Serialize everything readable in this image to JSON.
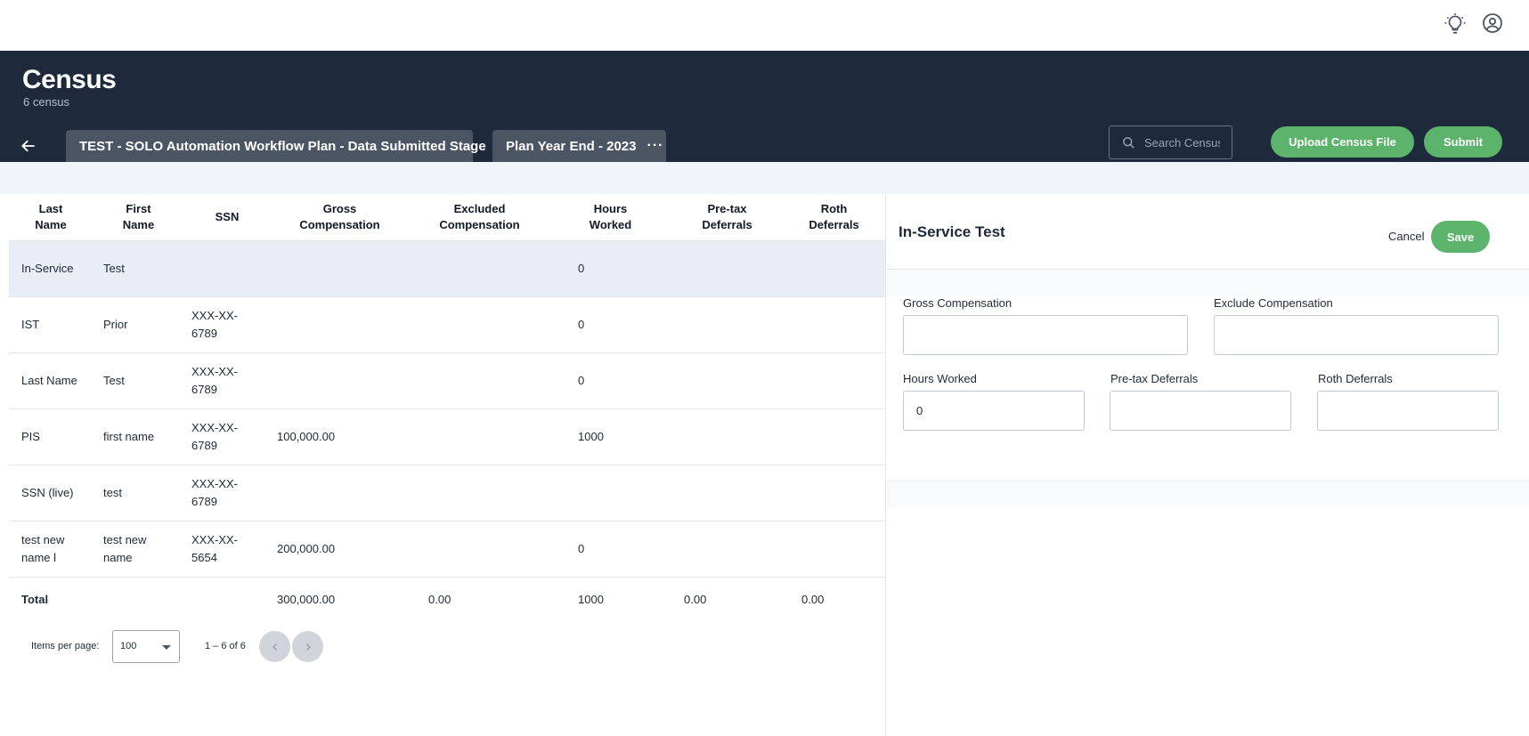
{
  "topbar": {
    "icons": [
      "lightbulb-icon",
      "account-circle-icon"
    ]
  },
  "header": {
    "title": "Census",
    "subtitle": "6 census",
    "tabs": [
      {
        "label": "TEST - SOLO Automation Workflow Plan - Data Submitted Stage"
      },
      {
        "label": "Plan Year End - 2023",
        "menu": "···"
      }
    ],
    "search": {
      "placeholder": "Search Census"
    },
    "upload_label": "Upload Census File",
    "submit_label": "Submit"
  },
  "table": {
    "columns": [
      {
        "line1": "Last",
        "line2": "Name"
      },
      {
        "line1": "First",
        "line2": "Name"
      },
      {
        "line1": "SSN",
        "line2": ""
      },
      {
        "line1": "Gross",
        "line2": "Compensation"
      },
      {
        "line1": "Excluded",
        "line2": "Compensation"
      },
      {
        "line1": "Hours",
        "line2": "Worked"
      },
      {
        "line1": "Pre-tax",
        "line2": "Deferrals"
      },
      {
        "line1": "Roth",
        "line2": "Deferrals"
      }
    ],
    "rows": [
      {
        "last_a": "In-Service",
        "last_b": "",
        "first_a": "Test",
        "first_b": "",
        "ssn_a": "",
        "ssn_b": "",
        "gross": "",
        "excluded": "",
        "hours": "0",
        "pretax": "",
        "roth": "",
        "selected": true
      },
      {
        "last_a": "IST",
        "last_b": "",
        "first_a": "Prior",
        "first_b": "",
        "ssn_a": "XXX-XX-",
        "ssn_b": "6789",
        "gross": "",
        "excluded": "",
        "hours": "0",
        "pretax": "",
        "roth": ""
      },
      {
        "last_a": "Last Name",
        "last_b": "",
        "first_a": "Test",
        "first_b": "",
        "ssn_a": "XXX-XX-",
        "ssn_b": "6789",
        "gross": "",
        "excluded": "",
        "hours": "0",
        "pretax": "",
        "roth": ""
      },
      {
        "last_a": "PIS",
        "last_b": "",
        "first_a": "first name",
        "first_b": "",
        "ssn_a": "XXX-XX-",
        "ssn_b": "6789",
        "gross": "100,000.00",
        "excluded": "",
        "hours": "1000",
        "pretax": "",
        "roth": ""
      },
      {
        "last_a": "SSN (live)",
        "last_b": "",
        "first_a": "test",
        "first_b": "",
        "ssn_a": "XXX-XX-",
        "ssn_b": "6789",
        "gross": "",
        "excluded": "",
        "hours": "",
        "pretax": "",
        "roth": ""
      },
      {
        "last_a": "test new",
        "last_b": "name l",
        "first_a": "test new",
        "first_b": "name",
        "ssn_a": "XXX-XX-",
        "ssn_b": "5654",
        "gross": "200,000.00",
        "excluded": "",
        "hours": "0",
        "pretax": "",
        "roth": ""
      }
    ],
    "total": {
      "label": "Total",
      "gross": "300,000.00",
      "excluded": "0.00",
      "hours": "1000",
      "pretax": "0.00",
      "roth": "0.00"
    }
  },
  "pager": {
    "items_label": "Items per page:",
    "per_page": "100",
    "range": "1 – 6 of 6"
  },
  "panel": {
    "title": "In-Service Test",
    "cancel_label": "Cancel",
    "save_label": "Save",
    "fields": {
      "gross": {
        "label": "Gross Compensation",
        "value": ""
      },
      "exclude": {
        "label": "Exclude Compensation",
        "value": ""
      },
      "hours": {
        "label": "Hours Worked",
        "value": "0"
      },
      "pretax": {
        "label": "Pre-tax Deferrals",
        "value": ""
      },
      "roth": {
        "label": "Roth Deferrals",
        "value": ""
      }
    }
  },
  "colors": {
    "header_bg": "#1e293b",
    "tab_bg": "#4b5563",
    "accent_green": "#5cb46c",
    "selected_row": "#e8edf6"
  }
}
